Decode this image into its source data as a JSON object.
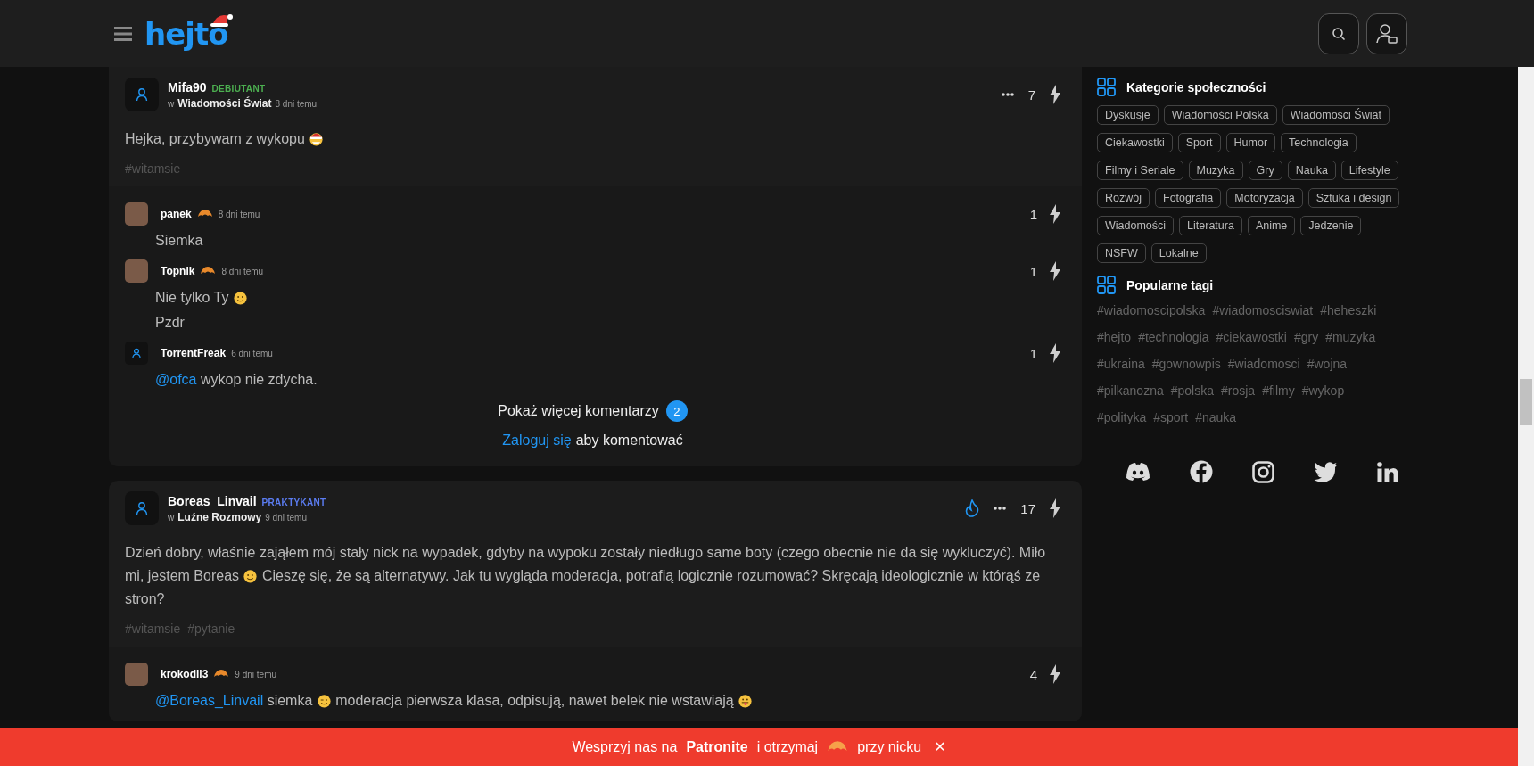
{
  "header": {
    "logo": "hejto"
  },
  "posts": [
    {
      "author": "Mifa90",
      "photo": false,
      "role": {
        "label": "DEBIUTANT",
        "color": "#4caf50"
      },
      "community_prefix": "w",
      "community": "Wiadomości Świat",
      "time": "8 dni temu",
      "hot": false,
      "votes": "7",
      "body": [
        [
          {
            "kind": "text",
            "text": "Hejka, przybywam z wykopu "
          },
          {
            "kind": "emoji_santa"
          }
        ]
      ],
      "tags": [
        "#witamsie"
      ],
      "comments": [
        {
          "author": "panek",
          "photo": true,
          "badge": true,
          "time": "8 dni temu",
          "votes": "1",
          "body": [
            [
              {
                "kind": "text",
                "text": "Siemka"
              }
            ]
          ]
        },
        {
          "author": "Topnik",
          "photo": true,
          "badge": true,
          "time": "8 dni temu",
          "votes": "1",
          "body": [
            [
              {
                "kind": "text",
                "text": "Nie tylko Ty "
              },
              {
                "kind": "emoji_smile"
              }
            ],
            [
              {
                "kind": "text",
                "text": "Pzdr"
              }
            ]
          ]
        },
        {
          "author": "TorrentFreak",
          "photo": false,
          "badge": false,
          "time": "6 dni temu",
          "votes": "1",
          "body": [
            [
              {
                "kind": "mention",
                "text": "@ofca"
              },
              {
                "kind": "text",
                "text": " wykop nie zdycha."
              }
            ]
          ]
        }
      ],
      "more": {
        "label": "Pokaż więcej komentarzy",
        "count": "2"
      },
      "login": {
        "link": "Zaloguj się",
        "text": "aby komentować"
      }
    },
    {
      "author": "Boreas_Linvail",
      "photo": false,
      "role": {
        "label": "PRAKTYKANT",
        "color": "#5b7cf0"
      },
      "community_prefix": "w",
      "community": "Luźne Rozmowy",
      "time": "9 dni temu",
      "hot": true,
      "votes": "17",
      "body": [
        [
          {
            "kind": "text",
            "text": "Dzień dobry, właśnie zająłem mój stały nick na wypadek, gdyby na wypoku zostały niedługo same boty (czego obecnie nie da się wykluczyć). Miło mi, jestem Boreas "
          },
          {
            "kind": "emoji_smile"
          },
          {
            "kind": "text",
            "text": " Cieszę się, że są alternatywy. Jak tu wygląda moderacja, potrafią logicznie rozumować? Skręcają ideologicznie w którąś ze stron?"
          }
        ]
      ],
      "tags": [
        "#witamsie",
        "#pytanie"
      ],
      "comments": [
        {
          "author": "krokodil3",
          "photo": true,
          "badge": true,
          "time": "9 dni temu",
          "votes": "4",
          "body": [
            [
              {
                "kind": "mention",
                "text": "@Boreas_Linvail"
              },
              {
                "kind": "text",
                "text": " siemka "
              },
              {
                "kind": "emoji_wink"
              },
              {
                "kind": "text",
                "text": " moderacja pierwsza klasa, odpisują, nawet belek nie wstawiają "
              },
              {
                "kind": "emoji_tongue"
              }
            ]
          ]
        }
      ]
    }
  ],
  "sidebar": {
    "categories_title": "Kategorie społeczności",
    "categories": [
      "Dyskusje",
      "Wiadomości Polska",
      "Wiadomości Świat",
      "Ciekawostki",
      "Sport",
      "Humor",
      "Technologia",
      "Filmy i Seriale",
      "Muzyka",
      "Gry",
      "Nauka",
      "Lifestyle",
      "Rozwój",
      "Fotografia",
      "Motoryzacja",
      "Sztuka i design",
      "Wiadomości",
      "Literatura",
      "Anime",
      "Jedzenie",
      "NSFW",
      "Lokalne"
    ],
    "tags_title": "Popularne tagi",
    "tags": [
      "#wiadomoscipolska",
      "#wiadomosciswiat",
      "#heheszki",
      "#hejto",
      "#technologia",
      "#ciekawostki",
      "#gry",
      "#muzyka",
      "#ukraina",
      "#gownowpis",
      "#wiadomosci",
      "#wojna",
      "#pilkanozna",
      "#polska",
      "#rosja",
      "#filmy",
      "#wykop",
      "#polityka",
      "#sport",
      "#nauka"
    ]
  },
  "banner": {
    "before": "Wesprzyj nas na",
    "link": "Patronite",
    "middle": "i otrzymaj",
    "after": "przy nicku",
    "close": "✕"
  }
}
